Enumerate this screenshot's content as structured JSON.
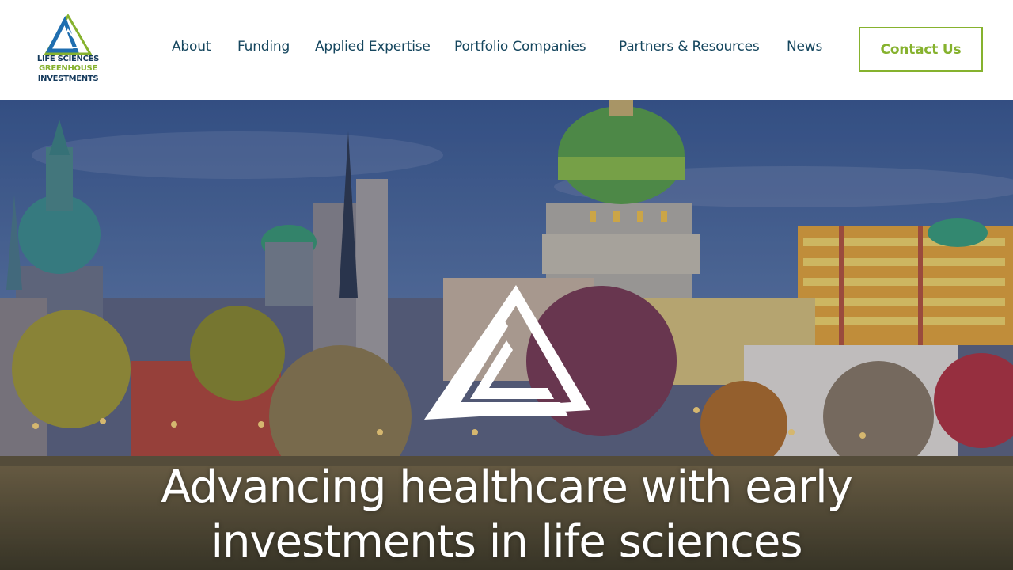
{
  "brand": {
    "logo_lines": [
      "LIFE SCIENCES",
      "GREENHOUSE",
      "INVESTMENTS"
    ],
    "colors": {
      "navy": "#143a5c",
      "blue": "#1f6eb0",
      "green": "#86b22e",
      "nav_text": "#15465e"
    }
  },
  "nav": {
    "items": [
      {
        "label": "About"
      },
      {
        "label": "Funding"
      },
      {
        "label": "Applied Expertise"
      },
      {
        "label": "Portfolio Companies"
      },
      {
        "label": "Partners & Resources"
      },
      {
        "label": "News"
      }
    ],
    "contact_label": "Contact Us"
  },
  "hero": {
    "heading_line1": "Advancing healthcare with early",
    "heading_line2": "investments in life sciences",
    "mark_icon": "triangle-logo-mark-icon"
  }
}
